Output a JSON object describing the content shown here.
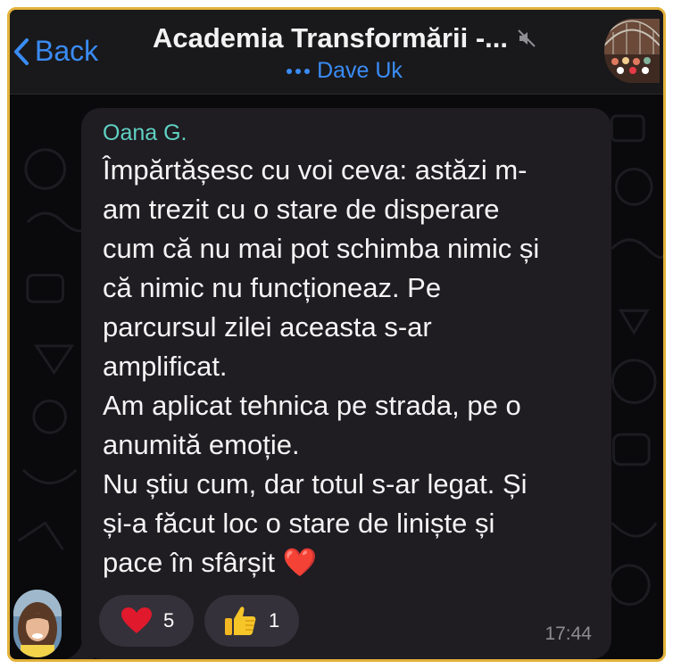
{
  "header": {
    "back_label": "Back",
    "title": "Academia Transformării -...",
    "subtitle": "Dave Uk"
  },
  "message": {
    "sender": "Oana G.",
    "text": "Împărtășesc cu voi ceva: astăzi m-\nam trezit cu o stare de disperare\ncum că nu mai pot schimba nimic și\ncă nimic nu funcționeaz. Pe\nparcursul zilei aceasta s-ar\namplificat.\nAm aplicat tehnica pe strada, pe o\nanumită emoție.\nNu știu cum, dar totul s-ar legat. Și\nși-a făcut loc o stare de liniște și\npace în sfârșit ❤️",
    "time": "17:44",
    "reactions": [
      {
        "icon": "heart-icon",
        "emoji": "❤️",
        "count": "5"
      },
      {
        "icon": "thumbs-up-icon",
        "emoji": "👍",
        "count": "1"
      }
    ]
  },
  "colors": {
    "accent": "#3a8cf6",
    "sender": "#5fd1c2",
    "border": "#e3b23c"
  }
}
